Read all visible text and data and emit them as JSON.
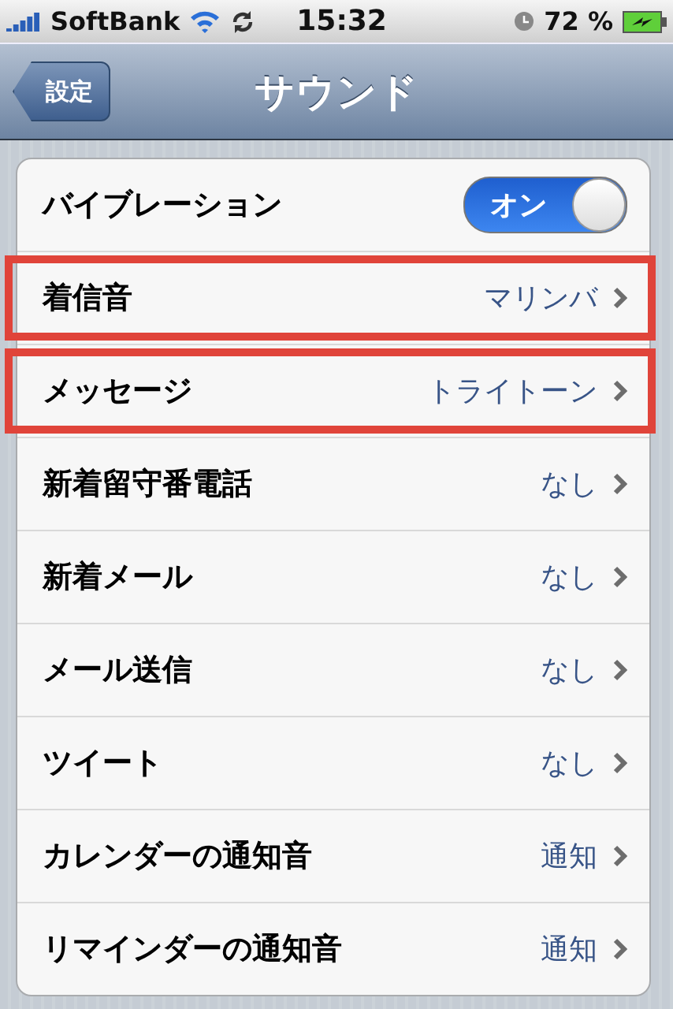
{
  "status_bar": {
    "carrier": "SoftBank",
    "time": "15:32",
    "battery": "72 %"
  },
  "nav_bar": {
    "back": "設定",
    "title": "サウンド"
  },
  "rows": [
    {
      "kind": "toggle",
      "label": "バイブレーション",
      "toggle_label": "オン",
      "on": true,
      "highlighted": false
    },
    {
      "kind": "link",
      "label": "着信音",
      "value": "マリンバ",
      "highlighted": true
    },
    {
      "kind": "link",
      "label": "メッセージ",
      "value": "トライトーン",
      "highlighted": true
    },
    {
      "kind": "link",
      "label": "新着留守番電話",
      "value": "なし",
      "highlighted": false
    },
    {
      "kind": "link",
      "label": "新着メール",
      "value": "なし",
      "highlighted": false
    },
    {
      "kind": "link",
      "label": "メール送信",
      "value": "なし",
      "highlighted": false
    },
    {
      "kind": "link",
      "label": "ツイート",
      "value": "なし",
      "highlighted": false
    },
    {
      "kind": "link",
      "label": "カレンダーの通知音",
      "value": "通知",
      "highlighted": false
    },
    {
      "kind": "link",
      "label": "リマインダーの通知音",
      "value": "通知",
      "highlighted": false
    }
  ]
}
